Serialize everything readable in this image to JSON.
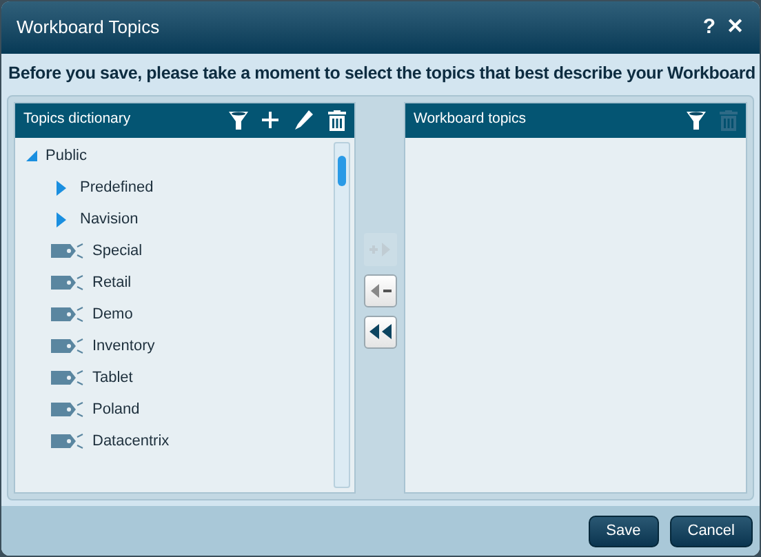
{
  "window": {
    "title": "Workboard Topics",
    "help": "?",
    "close": "✕"
  },
  "instruction": "Before you save, please take a moment to select the topics that best describe your Workboard",
  "dictionary": {
    "title": "Topics dictionary",
    "tree": [
      {
        "label": "Public",
        "kind": "folder",
        "expanded": true,
        "children": [
          {
            "label": "Predefined",
            "kind": "folder",
            "expanded": false
          },
          {
            "label": "Navision",
            "kind": "folder",
            "expanded": false
          },
          {
            "label": "Special",
            "kind": "topic"
          },
          {
            "label": "Retail",
            "kind": "topic"
          },
          {
            "label": "Demo",
            "kind": "topic"
          },
          {
            "label": "Inventory",
            "kind": "topic"
          },
          {
            "label": "Tablet",
            "kind": "topic"
          },
          {
            "label": "Poland",
            "kind": "topic"
          },
          {
            "label": "Datacentrix",
            "kind": "topic"
          }
        ]
      }
    ]
  },
  "transfer": [
    {
      "kind": "add",
      "disabled": true
    },
    {
      "kind": "remove",
      "disabled": false
    },
    {
      "kind": "remove_all",
      "disabled": false
    }
  ],
  "workboard": {
    "title": "Workboard topics",
    "delete_disabled": true
  },
  "buttons": [
    "Save",
    "Cancel"
  ]
}
